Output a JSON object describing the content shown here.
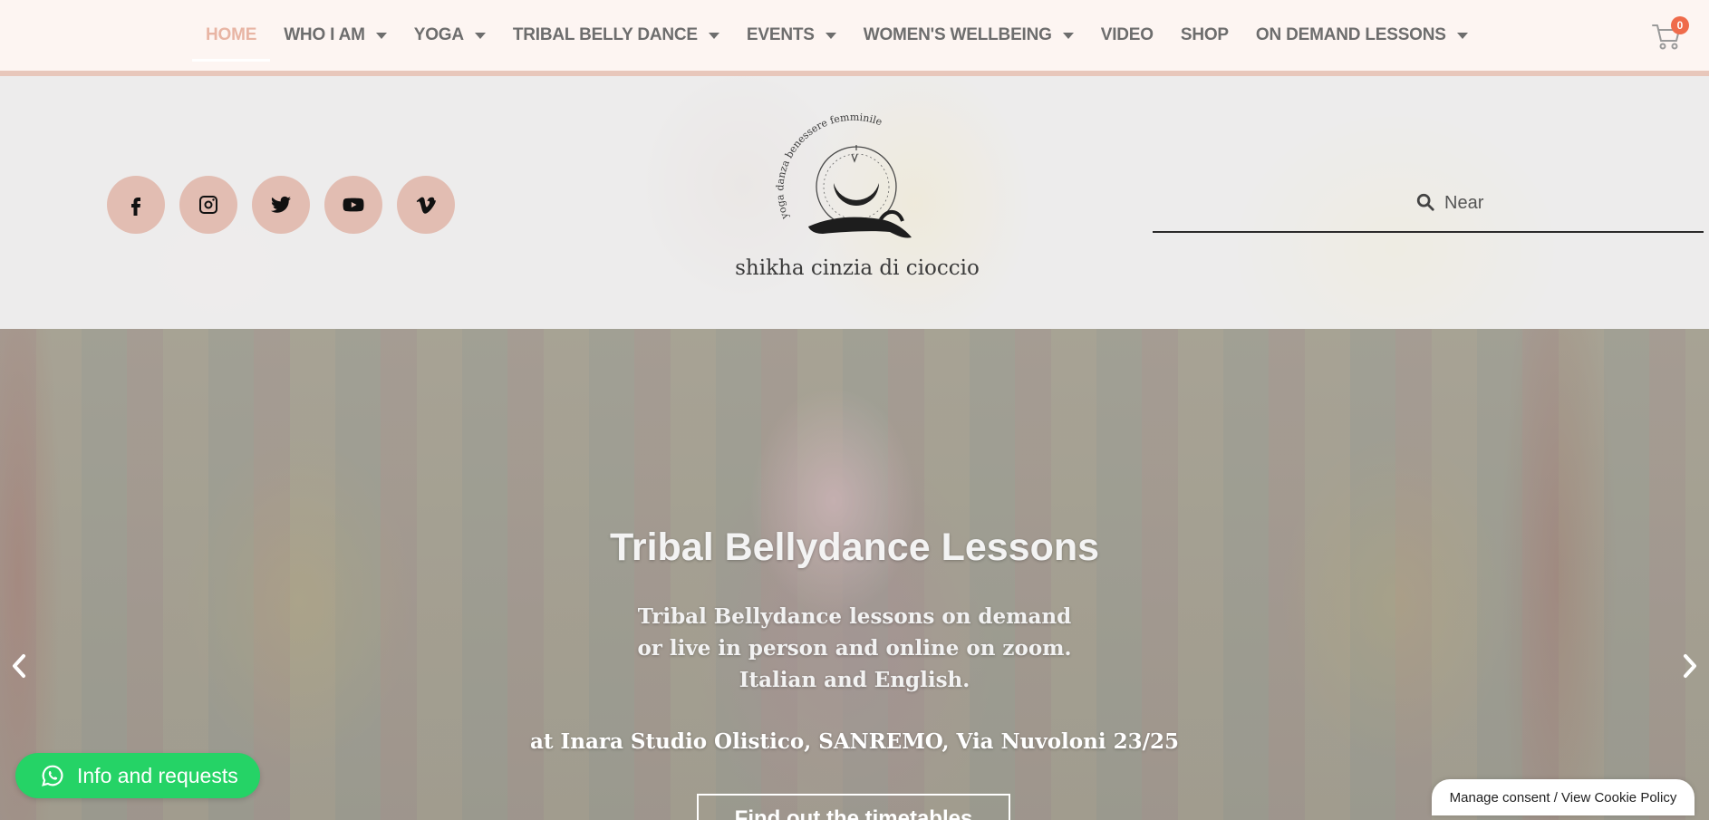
{
  "nav": {
    "items": [
      {
        "label": "HOME",
        "dropdown": false,
        "active": true
      },
      {
        "label": "WHO I AM",
        "dropdown": true
      },
      {
        "label": "YOGA",
        "dropdown": true
      },
      {
        "label": "TRIBAL BELLY DANCE",
        "dropdown": true
      },
      {
        "label": "EVENTS",
        "dropdown": true
      },
      {
        "label": "WOMEN'S WELLBEING",
        "dropdown": true
      },
      {
        "label": "VIDEO",
        "dropdown": false
      },
      {
        "label": "SHOP",
        "dropdown": false
      },
      {
        "label": "ON DEMAND LESSONS",
        "dropdown": true
      }
    ],
    "cart_count": "0",
    "cart_icon": "shopping-cart-icon"
  },
  "header": {
    "socials": [
      {
        "name": "facebook-icon"
      },
      {
        "name": "instagram-icon"
      },
      {
        "name": "twitter-icon"
      },
      {
        "name": "youtube-icon"
      },
      {
        "name": "vimeo-icon"
      }
    ],
    "logo": {
      "arc_text": "yoga danza benessere femminile",
      "caption": "shikha cinzia di cioccio"
    },
    "search": {
      "value": "",
      "placeholder": "Near"
    }
  },
  "hero": {
    "title": "Tribal Bellydance Lessons",
    "lines": [
      "Tribal Bellydance lessons on demand",
      "or live in person and online on zoom.",
      "Italian and English."
    ],
    "location": "at Inara Studio Olistico, SANREMO, Via Nuvoloni 23/25",
    "button_label": "Find out the timetables"
  },
  "widgets": {
    "whatsapp_label": "Info and requests",
    "consent_label": "Manage consent / View Cookie Policy"
  },
  "colors": {
    "nav_bg": "#fdf5f2",
    "nav_active": "#e8b5a4",
    "nav_border": "#e8c7bb",
    "social_bg": "#e2bdb2",
    "whatsapp": "#25d366",
    "cart_badge": "#ef6b4b"
  }
}
